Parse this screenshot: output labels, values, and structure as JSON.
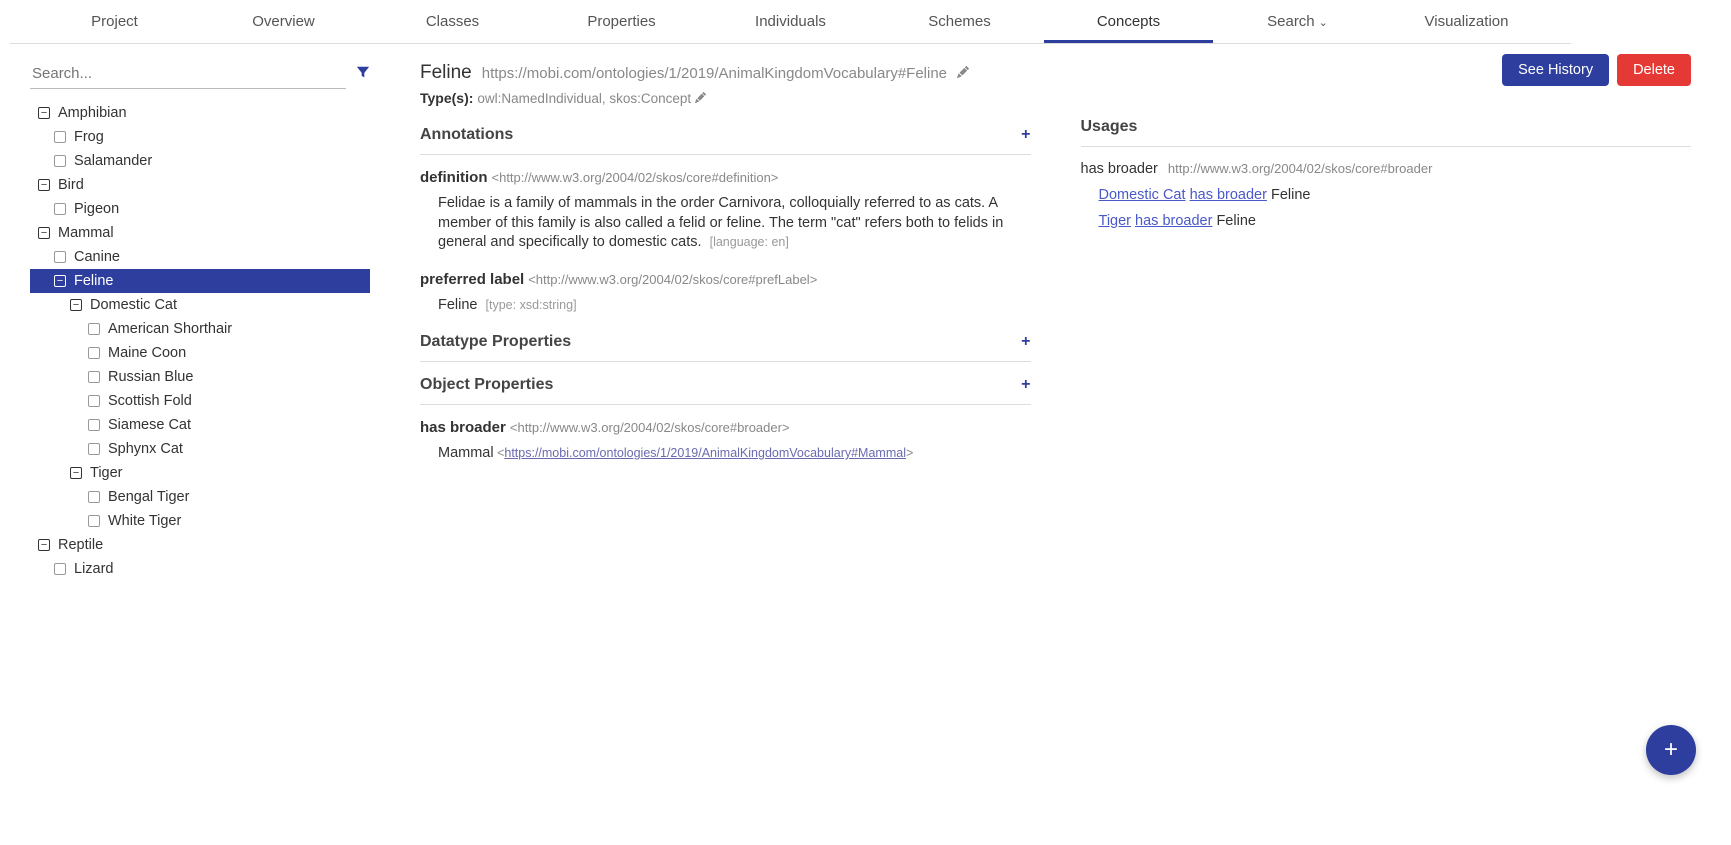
{
  "nav": {
    "tabs": [
      "Project",
      "Overview",
      "Classes",
      "Properties",
      "Individuals",
      "Schemes",
      "Concepts",
      "Search",
      "Visualization"
    ],
    "active": "Concepts"
  },
  "search": {
    "placeholder": "Search..."
  },
  "tree": {
    "nodes": [
      {
        "label": "Amphibian",
        "indent": 0,
        "expand": "minus"
      },
      {
        "label": "Frog",
        "indent": 1,
        "expand": "leaf"
      },
      {
        "label": "Salamander",
        "indent": 1,
        "expand": "leaf"
      },
      {
        "label": "Bird",
        "indent": 0,
        "expand": "minus"
      },
      {
        "label": "Pigeon",
        "indent": 1,
        "expand": "leaf"
      },
      {
        "label": "Mammal",
        "indent": 0,
        "expand": "minus"
      },
      {
        "label": "Canine",
        "indent": 1,
        "expand": "leaf"
      },
      {
        "label": "Feline",
        "indent": 1,
        "expand": "minus",
        "selected": true
      },
      {
        "label": "Domestic Cat",
        "indent": 2,
        "expand": "minus"
      },
      {
        "label": "American Shorthair",
        "indent": 3,
        "expand": "leaf"
      },
      {
        "label": "Maine Coon",
        "indent": 3,
        "expand": "leaf"
      },
      {
        "label": "Russian Blue",
        "indent": 3,
        "expand": "leaf"
      },
      {
        "label": "Scottish Fold",
        "indent": 3,
        "expand": "leaf"
      },
      {
        "label": "Siamese Cat",
        "indent": 3,
        "expand": "leaf"
      },
      {
        "label": "Sphynx Cat",
        "indent": 3,
        "expand": "leaf"
      },
      {
        "label": "Tiger",
        "indent": 2,
        "expand": "minus"
      },
      {
        "label": "Bengal Tiger",
        "indent": 3,
        "expand": "leaf"
      },
      {
        "label": "White Tiger",
        "indent": 3,
        "expand": "leaf"
      },
      {
        "label": "Reptile",
        "indent": 0,
        "expand": "minus"
      },
      {
        "label": "Lizard",
        "indent": 1,
        "expand": "leaf"
      }
    ]
  },
  "detail": {
    "title": "Feline",
    "iri": "https://mobi.com/ontologies/1/2019/AnimalKingdomVocabulary#Feline",
    "types_label": "Type(s):",
    "types": "owl:NamedIndividual, skos:Concept",
    "sections": {
      "annotations": "Annotations",
      "datatype": "Datatype Properties",
      "object": "Object Properties"
    },
    "annotations": [
      {
        "name": "definition",
        "iri": "<http://www.w3.org/2004/02/skos/core#definition>",
        "value": "Felidae is a family of mammals in the order Carnivora, colloquially referred to as cats. A member of this family is also called a felid or feline. The term \"cat\" refers both to felids in general and specifically to domestic cats.",
        "meta": "[language: en]"
      },
      {
        "name": "preferred label",
        "iri": "<http://www.w3.org/2004/02/skos/core#prefLabel>",
        "value": "Feline",
        "meta": "[type: xsd:string]"
      }
    ],
    "object_props": [
      {
        "name": "has broader",
        "iri": "<http://www.w3.org/2004/02/skos/core#broader>",
        "value_label": "Mammal",
        "value_link": "https://mobi.com/ontologies/1/2019/AnimalKingdomVocabulary#Mammal"
      }
    ]
  },
  "actions": {
    "history": "See History",
    "delete": "Delete"
  },
  "usages": {
    "title": "Usages",
    "prop_label": "has broader",
    "prop_iri": "http://www.w3.org/2004/02/skos/core#broader",
    "items": [
      {
        "subject": "Domestic Cat",
        "predicate": "has broader",
        "object": "Feline"
      },
      {
        "subject": "Tiger",
        "predicate": "has broader",
        "object": "Feline"
      }
    ]
  }
}
